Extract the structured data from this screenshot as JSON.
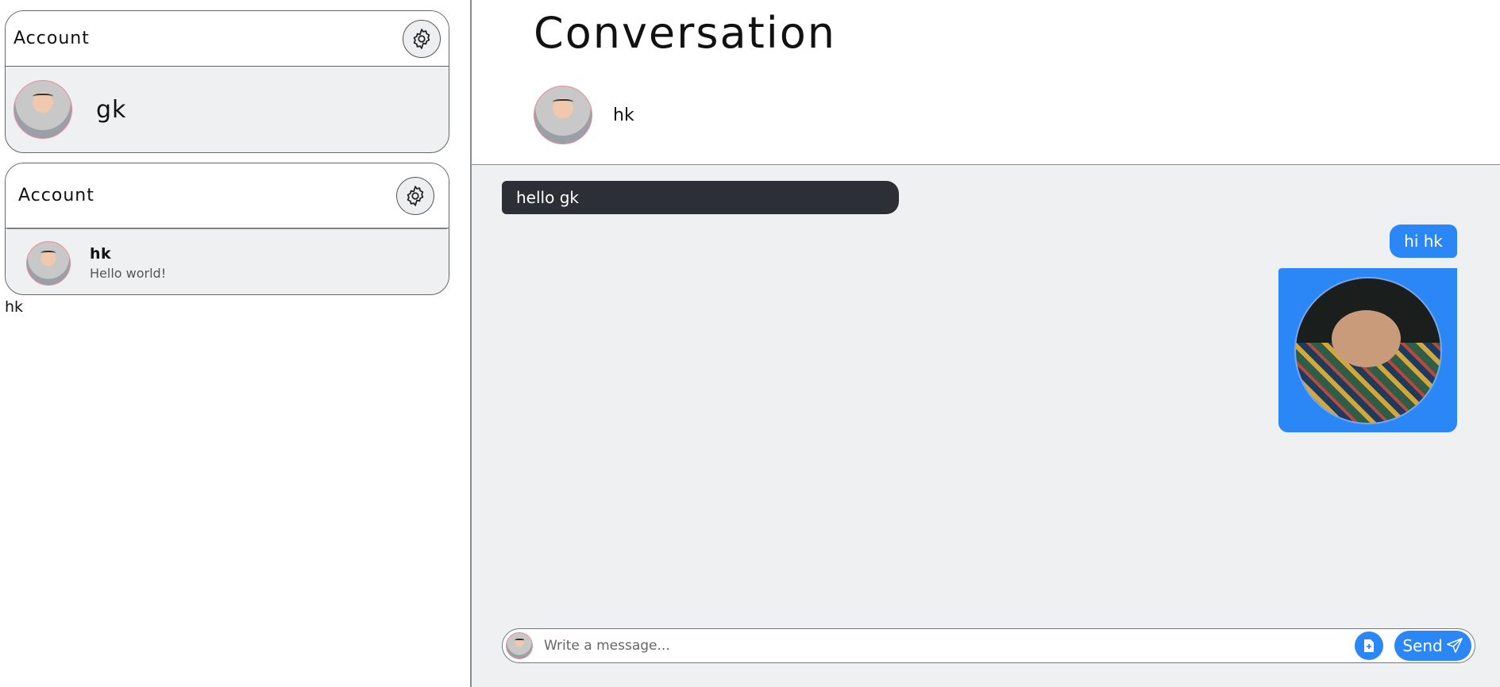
{
  "sidebar": {
    "account_card": {
      "title": "Account",
      "settings_icon": "gear-icon",
      "user_name": "gk"
    },
    "contacts_card": {
      "title": "Account",
      "settings_icon": "gear-icon",
      "contacts": [
        {
          "name": "hk",
          "last_message": "Hello world!"
        }
      ]
    },
    "selected_label": "hk"
  },
  "conversation": {
    "title": "Conversation",
    "participant_name": "hk",
    "messages": [
      {
        "direction": "incoming",
        "type": "text",
        "text": "hello gk"
      },
      {
        "direction": "outgoing",
        "type": "text",
        "text": "hi hk"
      },
      {
        "direction": "outgoing",
        "type": "image",
        "alt": "photo"
      }
    ]
  },
  "composer": {
    "placeholder": "Write a message...",
    "attach_icon": "file-plus-icon",
    "send_label": "Send",
    "send_icon": "paper-plane-icon"
  },
  "colors": {
    "accent": "#2b87f5",
    "incoming_bubble": "#2c3036",
    "chat_bg": "#eef0f2"
  }
}
